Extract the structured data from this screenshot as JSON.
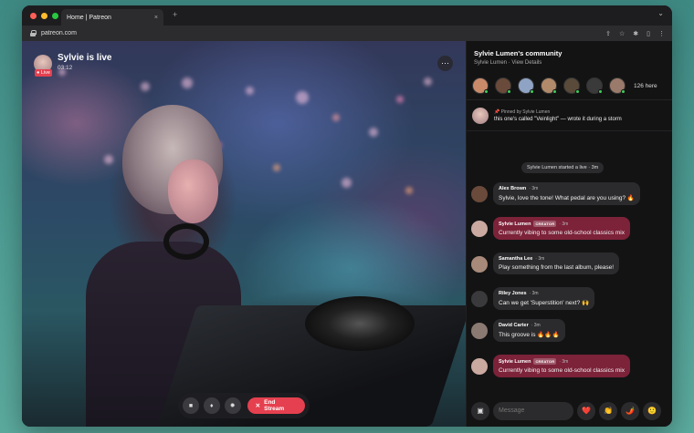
{
  "browser": {
    "tab_title": "Home | Patreon",
    "tab_close": "×",
    "new_tab": "+",
    "url": "patreon.com",
    "icons": [
      "share-icon",
      "star-icon",
      "extensions-icon",
      "sidebar-icon",
      "menu-icon"
    ]
  },
  "stream": {
    "host_name": "Sylvie is live",
    "elapsed": "03:12",
    "live_badge": "Live",
    "more": "···",
    "end_label": "End Stream",
    "control_icons": [
      "camera-icon",
      "mic-icon",
      "settings-icon"
    ]
  },
  "community": {
    "title": "Sylvie Lumen's community",
    "subtitle": "Sylvie Lumen · View Details",
    "viewer_count": "126 here",
    "viewer_colors": [
      "#c98a6a",
      "#6a4a3a",
      "#8fa3c4",
      "#b08a6a",
      "#5a4a3a",
      "#3a3a3a",
      "#9a7a6a"
    ],
    "pinned_label": "📌 Pinned by Sylvie Lumen",
    "pinned_text": "this one's called \"Veinlight\" — wrote it during a storm",
    "system_message": "Sylvie Lumen started a live · 3m"
  },
  "messages": [
    {
      "name": "Alex Brown",
      "badge": "",
      "time": "· 3m",
      "text": "Sylvie, love the tone! What pedal are you using? 🔥",
      "creator": false,
      "avatar": "#6a4a3a"
    },
    {
      "name": "Sylvie Lumen",
      "badge": "CREATOR",
      "time": "· 3m",
      "text": "Currently vibing to some old-school classics mix",
      "creator": true,
      "avatar": "#c9a9a0"
    },
    {
      "name": "Samantha Lee",
      "badge": "",
      "time": "· 3m",
      "text": "Play something from the last album, please!",
      "creator": false,
      "avatar": "#a88a7a"
    },
    {
      "name": "Riley Jones",
      "badge": "",
      "time": "· 3m",
      "text": "Can we get 'Superstition' next? 🙌",
      "creator": false,
      "avatar": "#3a3a3c"
    },
    {
      "name": "David Carter",
      "badge": "",
      "time": "· 3m",
      "text": "This groove is 🔥🔥🔥",
      "creator": false,
      "avatar": "#8a7a72"
    },
    {
      "name": "Sylvie Lumen",
      "badge": "CREATOR",
      "time": "· 3m",
      "text": "Currently vibing to some old-school classics mix",
      "creator": true,
      "avatar": "#c9a9a0"
    }
  ],
  "composer": {
    "placeholder": "Message",
    "reactions": [
      "❤️",
      "👏",
      "🌶️",
      "🙂"
    ]
  },
  "colors": {
    "accent": "#e5404f",
    "creator_bubble": "#7c2239",
    "online": "#3ecf5a"
  }
}
